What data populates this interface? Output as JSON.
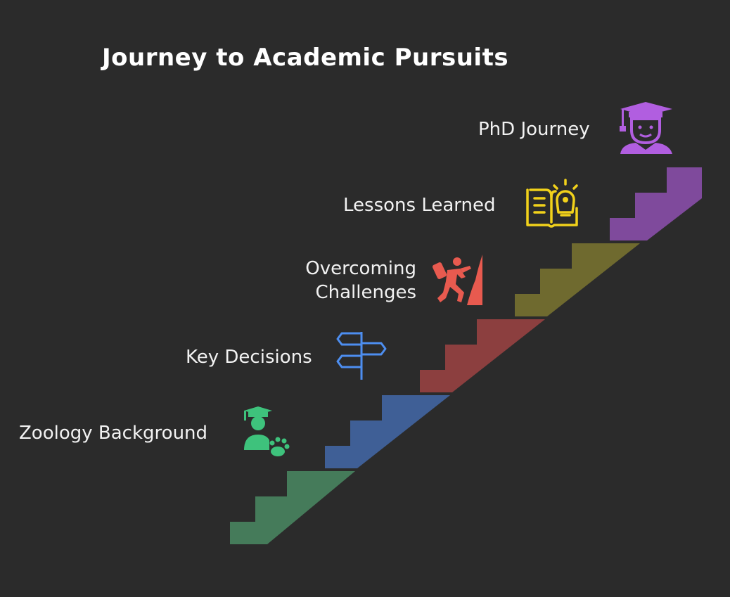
{
  "title": "Journey to Academic Pursuits",
  "steps": [
    {
      "label": "Zoology Background",
      "color": "#457b5a",
      "icon": "student-with-paw-icon",
      "icon_color": "#3ec27c"
    },
    {
      "label": "Key Decisions",
      "color": "#3f5f96",
      "icon": "signpost-icon",
      "icon_color": "#4d8ef0"
    },
    {
      "label": "Overcoming Challenges",
      "label_lines": [
        "Overcoming",
        "Challenges"
      ],
      "color": "#8c3f3f",
      "icon": "climber-icon",
      "icon_color": "#e85a4f"
    },
    {
      "label": "Lessons Learned",
      "color": "#6f6a2f",
      "icon": "book-lightbulb-icon",
      "icon_color": "#f2d21b"
    },
    {
      "label": "PhD Journey",
      "color": "#7f4a9c",
      "icon": "graduate-icon",
      "icon_color": "#b15ee0"
    }
  ]
}
